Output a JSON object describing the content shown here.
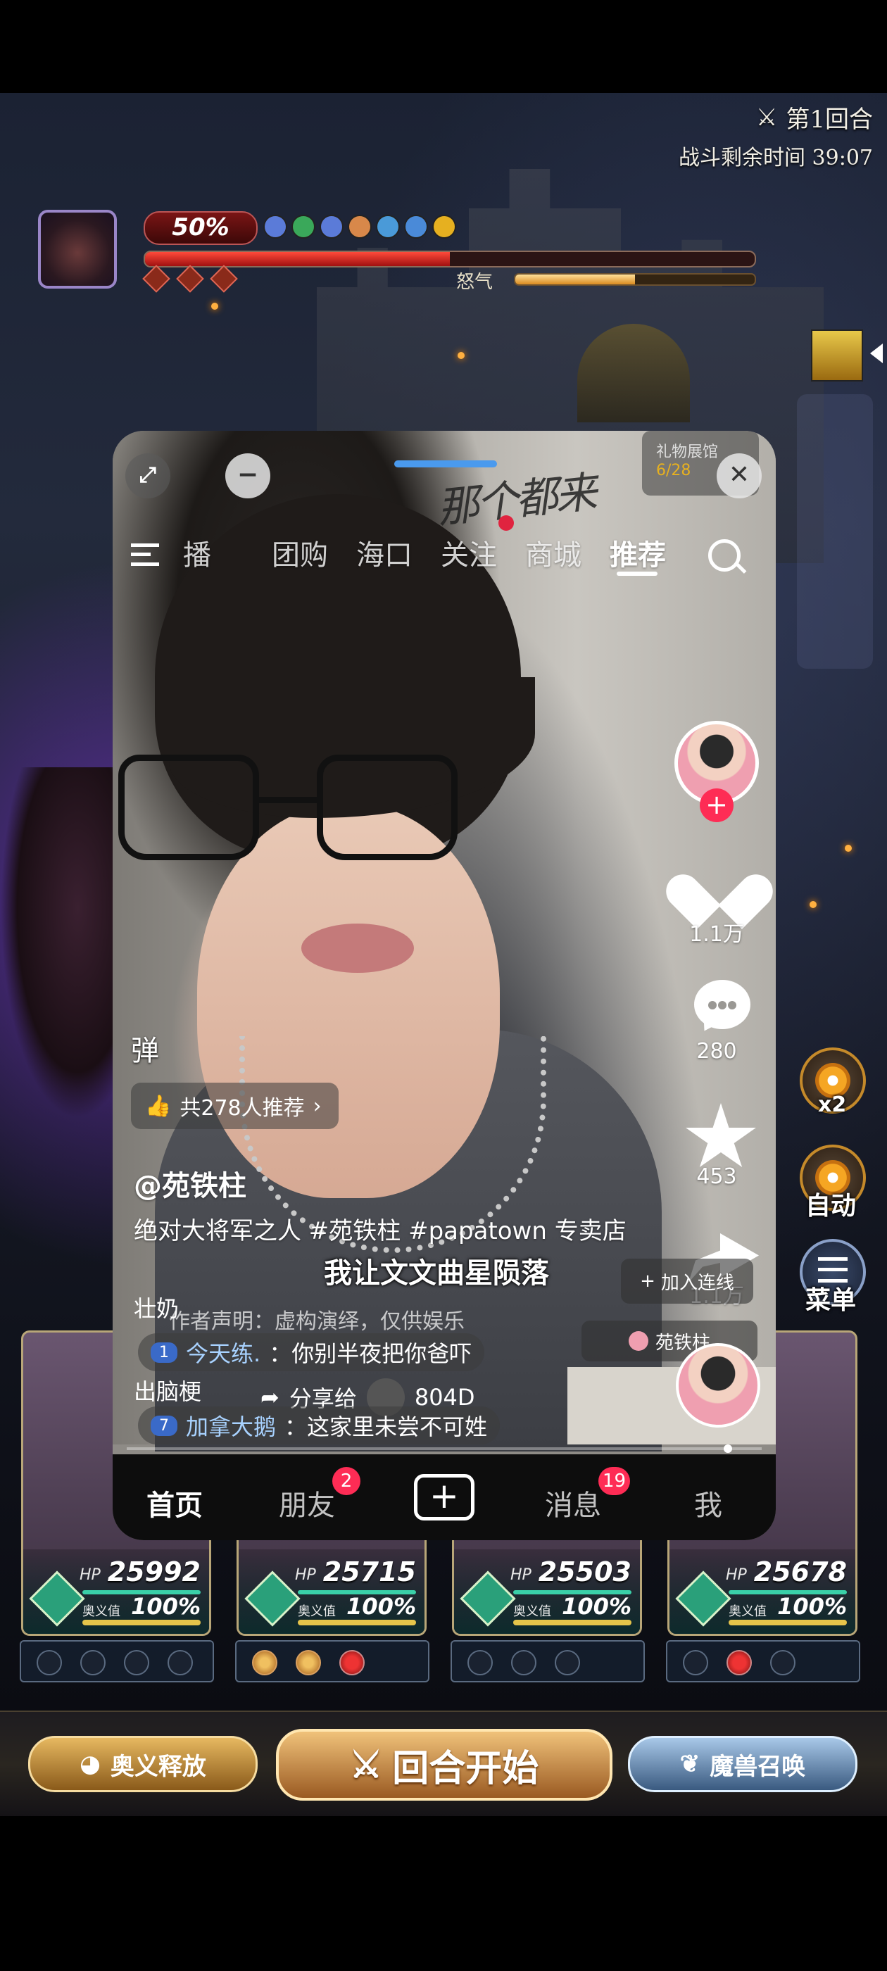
{
  "game": {
    "round": "第1回合",
    "timer": "战斗剩余时间 39:07",
    "boss_hp_percent_text": "50%",
    "boss_hp_fraction": 0.5,
    "rage_label": "怒气",
    "rage_fraction": 0.5,
    "buff_colors": [
      "#5b7bd8",
      "#3aa85a",
      "#5b7bd8",
      "#d8884a",
      "#4a9ad8",
      "#4a8ad8",
      "#e6b020"
    ],
    "side_buttons": {
      "speed": "x2",
      "auto": "自动",
      "menu": "菜单"
    },
    "heroes": [
      {
        "hp": "25992",
        "ao": "100%",
        "hp_label": "HP",
        "ao_label": "奥义值",
        "slots": [
          "empty",
          "empty",
          "empty",
          "empty"
        ]
      },
      {
        "hp": "25715",
        "ao": "100%",
        "hp_label": "HP",
        "ao_label": "奥义值",
        "slots": [
          "orange",
          "orange",
          "red"
        ]
      },
      {
        "hp": "25503",
        "ao": "100%",
        "hp_label": "HP",
        "ao_label": "奥义值",
        "slots": [
          "empty",
          "empty",
          "empty"
        ]
      },
      {
        "hp": "25678",
        "ao": "100%",
        "hp_label": "HP",
        "ao_label": "奥义值",
        "slots": [
          "empty",
          "red",
          "empty"
        ]
      }
    ],
    "actions": {
      "ao_release": "奥义释放",
      "start_round": "回合开始",
      "summon": "魔兽召唤"
    }
  },
  "douyin": {
    "gift_box": {
      "label": "礼物展馆",
      "count": "6/28"
    },
    "nav_tabs": [
      "播",
      "团购",
      "海口",
      "关注",
      "商城",
      "推荐"
    ],
    "active_tab": "推荐",
    "signature": "那个都来",
    "likes": "1.1万",
    "comments": "280",
    "favorites": "453",
    "shares": "1.1万",
    "danmu_label": "弹",
    "recommend": "共278人推荐",
    "username": "@苑铁柱",
    "description": "绝对大将军之人 #苑铁柱 #papatown 专卖店",
    "overlay_text": "我让文文曲星陨落",
    "disclaimer": "作者声明：虚构演绎，仅供娱乐",
    "comment_prefix_1": "壮奶",
    "comment_prefix_2": "出脑梗",
    "join_label": "加入连线",
    "live_host": "苑铁柱",
    "comments_list": [
      {
        "level": "1",
        "name": "今天练.",
        "text": "：你别半夜把你爸吓"
      },
      {
        "level": "7",
        "name": "加拿大鹅",
        "text": "：这家里未尝不可姓"
      }
    ],
    "share_to": "分享给",
    "share_target": "804D",
    "bottom_tabs": {
      "home": "首页",
      "friends": "朋友",
      "messages": "消息",
      "me": "我"
    },
    "friends_badge": "2",
    "messages_badge": "19"
  }
}
